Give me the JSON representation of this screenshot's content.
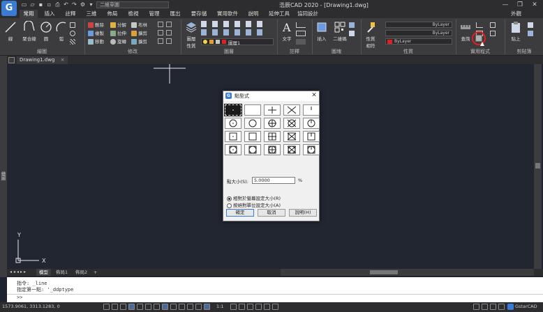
{
  "app": {
    "logo_letter": "G",
    "title": "浩辰CAD 2020 - [Drawing1.dwg]",
    "workspace": "二維草圖",
    "window_controls": [
      "—",
      "❐",
      "✕"
    ]
  },
  "menu_tabs": [
    "常用",
    "插入",
    "註釋",
    "三維",
    "佈局",
    "檢視",
    "管理",
    "匯出",
    "要存儲",
    "實用軟件",
    "說明",
    "延伸工具",
    "協同設計"
  ],
  "menu_outer": "外觀",
  "ribbon": {
    "draw": {
      "title": "繪圖",
      "line": "線",
      "polyline": "聚合線",
      "circle": "圓",
      "arc": "弧"
    },
    "modify": {
      "title": "修改",
      "erase": "刪除",
      "explode": "分解",
      "fillet": "布林",
      "copy": "複製",
      "stretch": "拉伸",
      "trim": "擴剪",
      "move": "移動",
      "rotate": "旋轉",
      "mirror": "擴剪"
    },
    "layer": {
      "title": "圖層",
      "props": "圖層\n性質",
      "current": "圖層1"
    },
    "annotation": {
      "title": "註釋",
      "text": "文字"
    },
    "block": {
      "title": "圖塊",
      "insert": "插入",
      "qrcode": "二維碼"
    },
    "properties": {
      "title": "性質",
      "match": "性質\n相符",
      "bylayer1": "ByLayer",
      "bylayer2": "ByLayer",
      "bylayer3": "ByLayer"
    },
    "utilities": {
      "title": "實用程式",
      "query": "查詢"
    },
    "clipboard": {
      "title": "剪貼簿",
      "paste": "貼上"
    }
  },
  "doc_tab": "Drawing1.dwg",
  "left_label": "繪圖",
  "layout_tabs": [
    "模型",
    "佈局1",
    "佈局2"
  ],
  "command": {
    "history": [
      "指令: _line",
      "指定第一點: '_ddptype"
    ],
    "prompt": ">>"
  },
  "status": {
    "coords": "1573.9061, 3313.1283, 0",
    "scale": "1:1",
    "brand": "GstarCAD"
  },
  "dialog": {
    "title": "點型式",
    "size_label": "點大小(S):",
    "size_value": "5.0000",
    "size_unit": "%",
    "radio_relative": "相對於螢幕設定大小(R)",
    "radio_absolute": "按絕對單位設定大小(A)",
    "ok": "確定",
    "cancel": "取消",
    "help": "說明(H)",
    "selected_index": 0
  },
  "colors": {
    "canvas": "#212631",
    "ribbon": "#3c3c3f",
    "accent": "#3a7bd5",
    "highlight_ring": "#e02020"
  }
}
